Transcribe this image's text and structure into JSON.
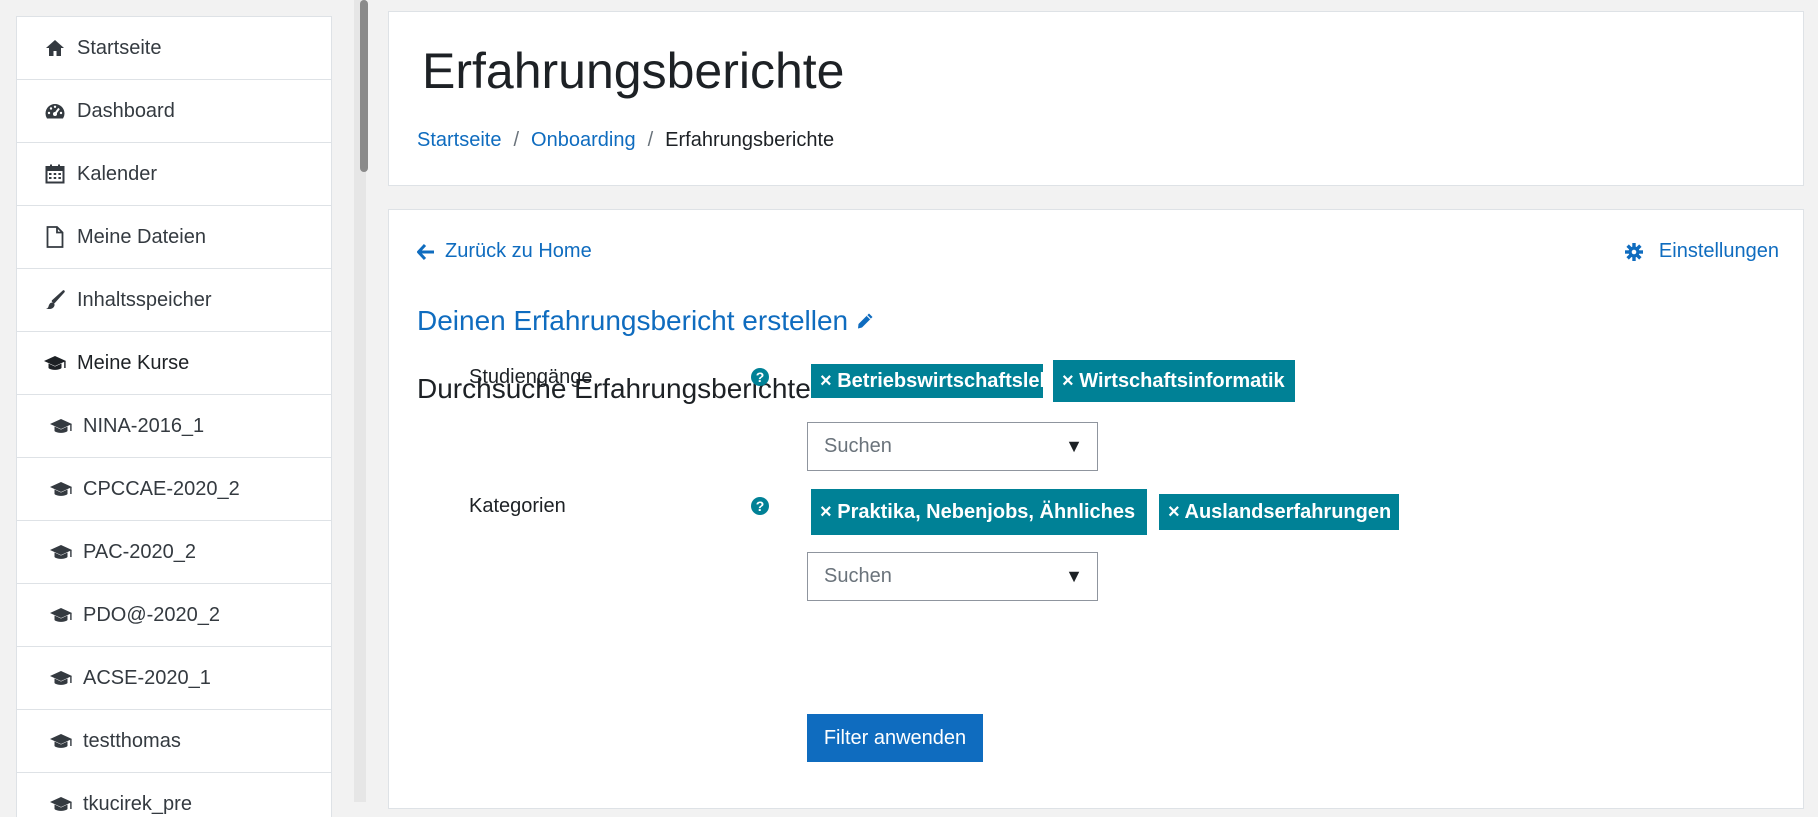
{
  "nav": {
    "items": [
      {
        "label": "Startseite",
        "icon": "home-icon"
      },
      {
        "label": "Dashboard",
        "icon": "dashboard-icon"
      },
      {
        "label": "Kalender",
        "icon": "calendar-icon"
      },
      {
        "label": "Meine Dateien",
        "icon": "file-icon"
      },
      {
        "label": "Inhaltsspeicher",
        "icon": "paintbrush-icon"
      },
      {
        "label": "Meine Kurse",
        "icon": "graduation-cap-icon"
      }
    ],
    "courses": [
      {
        "label": "NINA-2016_1"
      },
      {
        "label": "CPCCAE-2020_2"
      },
      {
        "label": "PAC-2020_2"
      },
      {
        "label": "PDO@-2020_2"
      },
      {
        "label": "ACSE-2020_1"
      },
      {
        "label": "testthomas"
      },
      {
        "label": "tkucirek_pre"
      }
    ]
  },
  "header": {
    "title": "Erfahrungsberichte",
    "breadcrumb": [
      "Startseite",
      "Onboarding",
      "Erfahrungsberichte"
    ],
    "separator": "/"
  },
  "main": {
    "back_link": "Zurück zu Home",
    "settings_link": "Einstellungen",
    "create_link": "Deinen Erfahrungsbericht erstellen",
    "search_heading": "Durchsuche Erfahrungsberichte",
    "help_glyph": "?",
    "studiengaenge": {
      "label": "Studiengänge",
      "tags": [
        "× Betriebswirtschaftslehre",
        "× Wirtschaftsinformatik"
      ],
      "select_placeholder": "Suchen",
      "caret": "▼"
    },
    "kategorien": {
      "label": "Kategorien",
      "tags": [
        "× Praktika, Nebenjobs, Ähnliches",
        "× Auslandserfahrungen"
      ],
      "select_placeholder": "Suchen",
      "caret": "▼"
    },
    "apply_button": "Filter anwenden"
  },
  "colors": {
    "link": "#0f6cbf",
    "tag": "#008196",
    "primary_button": "#0f6cbf",
    "text": "#1d2125"
  }
}
